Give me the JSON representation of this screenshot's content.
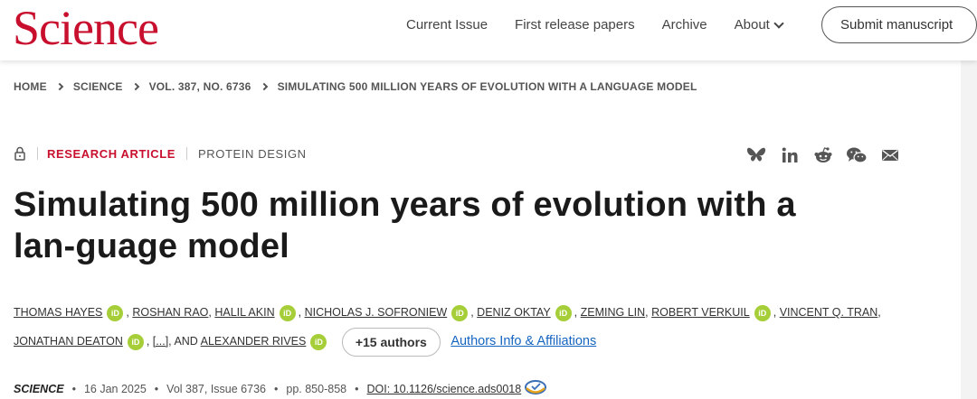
{
  "header": {
    "logo": "Science",
    "nav": [
      "Current Issue",
      "First release papers",
      "Archive"
    ],
    "about": "About",
    "submit": "Submit manuscript"
  },
  "breadcrumb": [
    "HOME",
    "SCIENCE",
    "VOL. 387, NO. 6736",
    "SIMULATING 500 MILLION YEARS OF EVOLUTION WITH A LANGUAGE MODEL"
  ],
  "article": {
    "type": "RESEARCH ARTICLE",
    "topic": "PROTEIN DESIGN",
    "title": "Simulating 500 million years of evolution with a lan-guage model",
    "authors": {
      "a1": "THOMAS HAYES",
      "a2": "ROSHAN RAO",
      "a3": "HALIL AKIN",
      "a4": "NICHOLAS J. SOFRONIEW",
      "a5": "DENIZ OKTAY",
      "a6": "ZEMING LIN",
      "a7": "ROBERT VERKUIL",
      "a8": "VINCENT Q. TRAN",
      "a9": "JONATHAN DEATON",
      "ellipsis": "[...]",
      "and": "AND",
      "a10": "ALEXANDER RIVES",
      "more": "+15 authors",
      "affiliations": "Authors Info & Affiliations"
    },
    "orcid_label": "iD",
    "citation": {
      "journal": "SCIENCE",
      "date": "16 Jan 2025",
      "volume": "Vol 387, Issue 6736",
      "pages": "pp. 850-858",
      "doi": "DOI: 10.1126/science.ads0018"
    }
  },
  "colors": {
    "brand": "#c8102e",
    "orcid": "#a6ce39",
    "link": "#1565c0"
  },
  "share_icons": [
    "bluesky-icon",
    "linkedin-icon",
    "reddit-icon",
    "wechat-icon",
    "email-icon"
  ]
}
